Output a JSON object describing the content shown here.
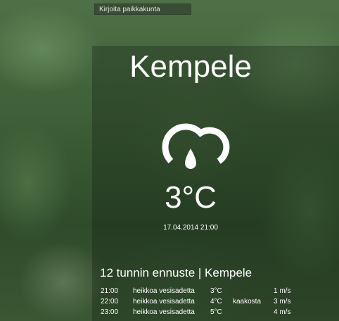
{
  "search": {
    "placeholder": "Kirjoita paikkakunta"
  },
  "current": {
    "city": "Kempele",
    "icon": "cloud-rain-icon",
    "temperature": "3°C",
    "datetime": "17.04.2014 21:00"
  },
  "forecast": {
    "title": "12 tunnin ennuste | Kempele",
    "rows": [
      {
        "time": "21:00",
        "description": "heikkoa vesisadetta",
        "temp": "3°C",
        "wind_dir": "",
        "wind_speed": "1 m/s"
      },
      {
        "time": "22:00",
        "description": "heikkoa vesisadetta",
        "temp": "4°C",
        "wind_dir": "kaakosta",
        "wind_speed": "3 m/s"
      },
      {
        "time": "23:00",
        "description": "heikkoa vesisadetta",
        "temp": "5°C",
        "wind_dir": "",
        "wind_speed": "4 m/s"
      }
    ]
  },
  "colors": {
    "text": "#ffffff",
    "panel": "#1e2b1e"
  }
}
